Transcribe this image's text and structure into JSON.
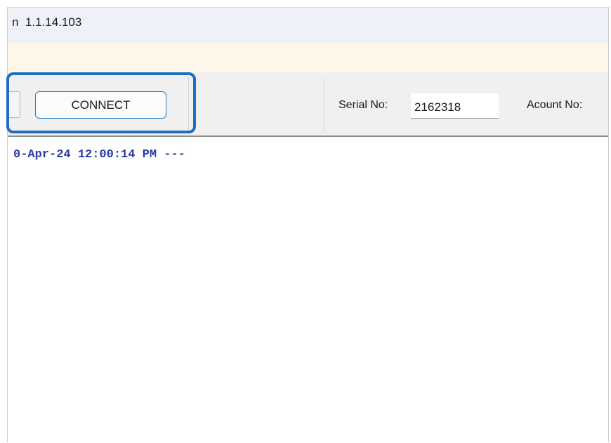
{
  "window": {
    "title": "n  1.1.14.103"
  },
  "toolbar": {
    "connect_label": "CONNECT",
    "serial_label": "Serial No:",
    "serial_value": "2162318",
    "account_label": "Acount No:"
  },
  "log": {
    "lines": [
      "0-Apr-24 12:00:14 PM ---"
    ]
  },
  "colors": {
    "highlight": "#1e6fbf",
    "log_text": "#2a3aa6",
    "notice_bar": "#fdf6e9",
    "titlebar": "#eef2f8"
  }
}
